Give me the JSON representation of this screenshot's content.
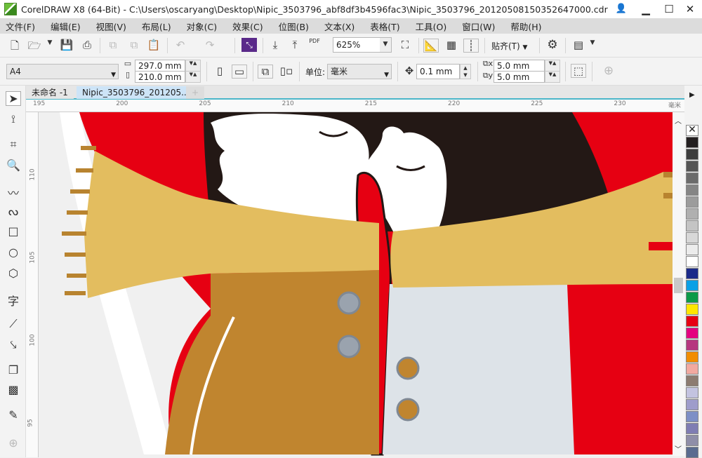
{
  "window": {
    "title": "CorelDRAW X8 (64-Bit) - C:\\Users\\oscaryang\\Desktop\\Nipic_3503796_abf8df3b4596fac3\\Nipic_3503796_20120508150352647000.cdr",
    "minimize": "▁",
    "maximize": "☐",
    "close": "✕"
  },
  "menu": [
    "文件(F)",
    "编辑(E)",
    "视图(V)",
    "布局(L)",
    "对象(C)",
    "效果(C)",
    "位图(B)",
    "文本(X)",
    "表格(T)",
    "工具(O)",
    "窗口(W)",
    "帮助(H)"
  ],
  "toolbar": {
    "zoom": "625%",
    "pdf": "PDF",
    "snap": "贴齐(T)"
  },
  "property_bar": {
    "page_size": "A4",
    "width": "297.0 mm",
    "height": "210.0 mm",
    "unit_label": "单位:",
    "unit": "毫米",
    "nudge": "0.1 mm",
    "dup_x": "5.0 mm",
    "dup_y": "5.0 mm"
  },
  "tabs": [
    {
      "label": "未命名 -1",
      "active": false
    },
    {
      "label": "Nipic_3503796_201205...",
      "active": true
    }
  ],
  "tab_add": "+",
  "rulers": {
    "horizontal": [
      "195",
      "200",
      "205",
      "210",
      "215",
      "220",
      "225",
      "230"
    ],
    "vertical": [
      "110",
      "105",
      "100",
      "95"
    ],
    "unit": "毫米"
  },
  "tools": [
    "pick-tool",
    "shape-tool",
    "crop-tool",
    "zoom-tool",
    "freehand-tool",
    "artistic-media-tool",
    "rectangle-tool",
    "ellipse-tool",
    "polygon-tool",
    "text-tool",
    "parallel-dimension-tool",
    "connector-tool",
    "drop-shadow-tool",
    "transparency-tool",
    "color-eyedropper-tool",
    "add-tool"
  ],
  "text_tool_glyph": "字",
  "palette": [
    "#231f20",
    "#3d3d3d",
    "#545454",
    "#6b6b6b",
    "#858585",
    "#9c9c9c",
    "#b0b0b0",
    "#c4c4c4",
    "#d8d8d8",
    "#ececec",
    "#ffffff",
    "#1b2a8a",
    "#0aa0e6",
    "#0d9a48",
    "#ffe600",
    "#e60012",
    "#e4007f",
    "#b6367f",
    "#f18d00",
    "#f2a9a0",
    "#8c7b70",
    "#c3c3e0",
    "#9e9ccb",
    "#7d8fc6",
    "#7f7db3",
    "#8f8ea8",
    "#5a6b8f"
  ],
  "colors": {
    "red": "#e60012",
    "hair": "#231815",
    "scarf": "#e3bd5f",
    "fringe": "#b8832f",
    "coat_left": "#c0852f",
    "coat_right": "#dde3e8",
    "button_grey": "#9aa3ae"
  }
}
